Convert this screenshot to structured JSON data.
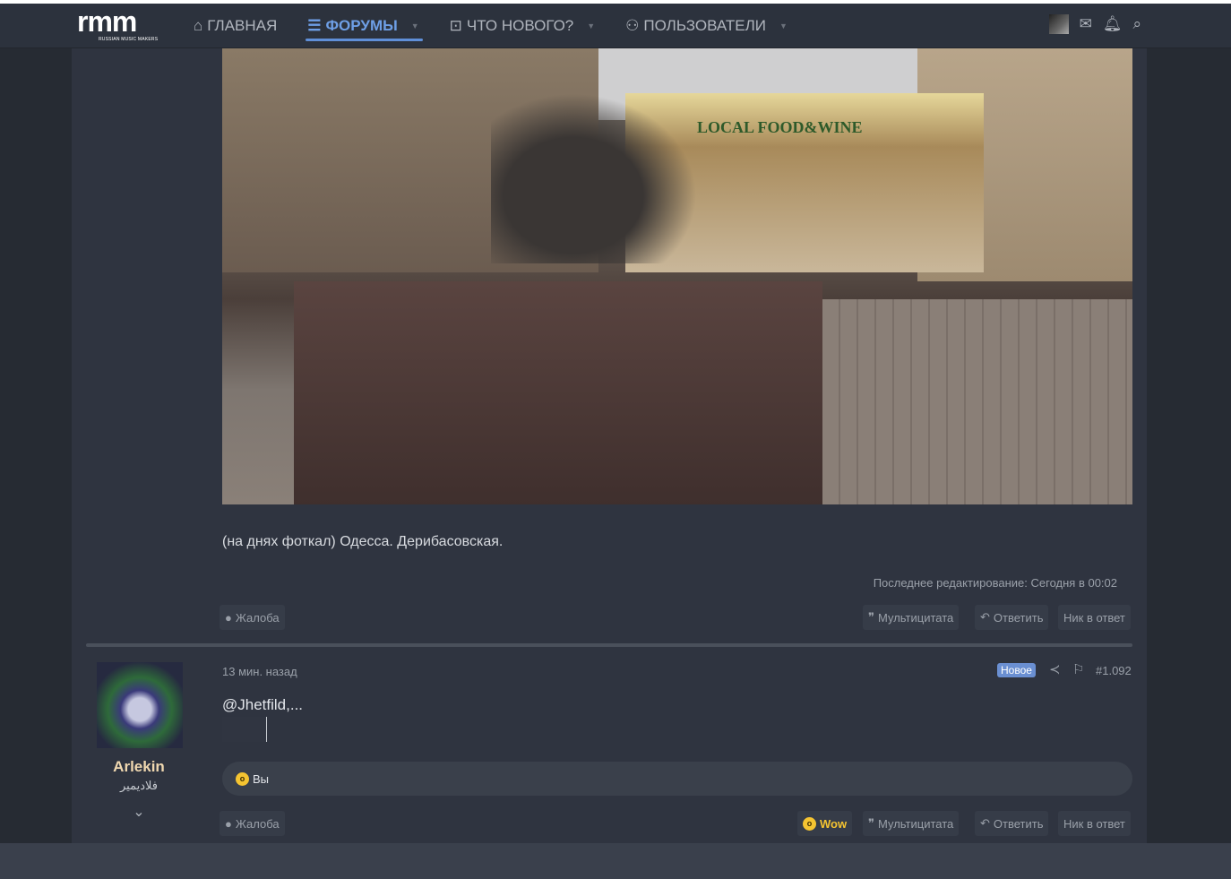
{
  "logo": {
    "text": "rmm",
    "subtitle": "RUSSIAN MUSIC MAKERS"
  },
  "nav": [
    {
      "label": "ГЛАВНАЯ",
      "icon": "home-icon"
    },
    {
      "label": "ФОРУМЫ",
      "icon": "forum-icon",
      "active": true
    },
    {
      "label": "ЧТО НОВОГО?",
      "icon": "whats-new-icon"
    },
    {
      "label": "ПОЛЬЗОВАТЕЛИ",
      "icon": "users-icon"
    }
  ],
  "photo": {
    "sign": "LOCAL FOOD&WINE"
  },
  "post1": {
    "caption": "(на днях фоткал) Одесса. Дерибасовская.",
    "edited": "Последнее редактирование: Сегодня в 00:02",
    "report": "Жалоба",
    "multiquote": "Мультицитата",
    "reply": "Ответить",
    "nick": "Ник в ответ"
  },
  "post2": {
    "username": "Arlekin",
    "user_title": "فلاديمير",
    "time": "13 мин. назад",
    "badge": "Новое",
    "number": "#1.092",
    "message": "@Jhetfild,...",
    "reactions_text": "Вы",
    "report": "Жалоба",
    "wow": "Wow",
    "multiquote": "Мультицитата",
    "reply": "Ответить",
    "nick": "Ник в ответ"
  },
  "colors": {
    "accent": "#6e9fe6",
    "badge": "#6a8fd2",
    "username": "#f0d8b0"
  }
}
